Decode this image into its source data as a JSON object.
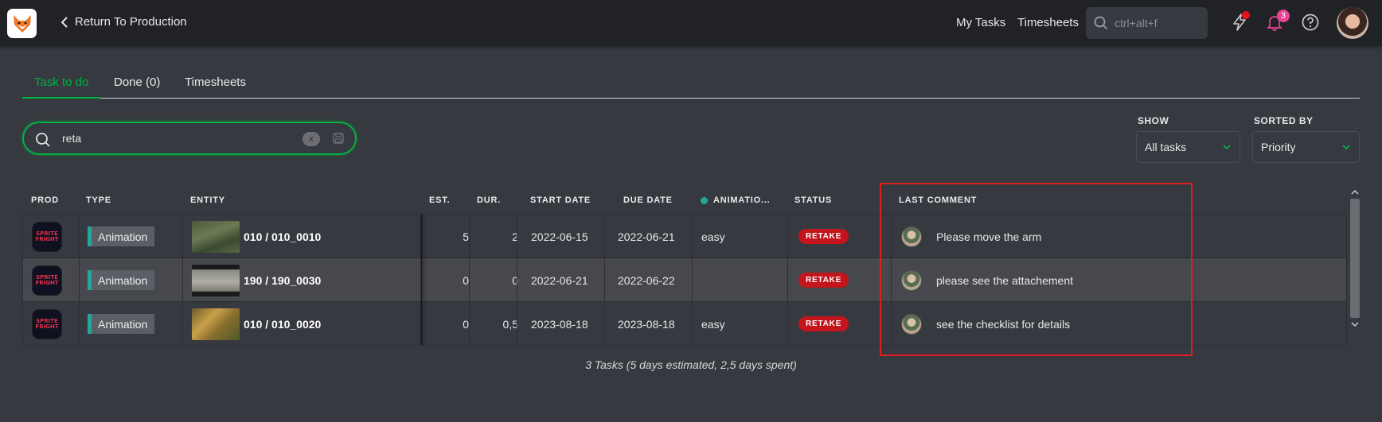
{
  "topbar": {
    "back_label": "Return To Production",
    "nav": {
      "my_tasks": "My Tasks",
      "timesheets": "Timesheets"
    },
    "search_placeholder": "ctrl+alt+f",
    "notifications_count": "3"
  },
  "tabs": [
    {
      "label": "Task to do",
      "active": true
    },
    {
      "label": "Done (0)",
      "active": false
    },
    {
      "label": "Timesheets",
      "active": false
    }
  ],
  "search": {
    "value": "reta",
    "clear_label": "x"
  },
  "filters": {
    "show": {
      "label": "SHOW",
      "value": "All tasks"
    },
    "sorted_by": {
      "label": "SORTED BY",
      "value": "Priority"
    }
  },
  "table": {
    "columns": {
      "prod": "PROD",
      "type": "TYPE",
      "entity": "ENTITY",
      "est": "EST.",
      "dur": "DUR.",
      "start_date": "START DATE",
      "due_date": "DUE DATE",
      "animation": "ANIMATIO...",
      "status": "STATUS",
      "last_comment": "LAST COMMENT"
    },
    "prod_thumb_text": [
      "SPRITE",
      "FRIGHT"
    ],
    "rows": [
      {
        "type": "Animation",
        "entity": "010 / 010_0010",
        "est": "5",
        "dur": "2",
        "start_date": "2022-06-15",
        "due_date": "2022-06-21",
        "animation": "easy",
        "status": "RETAKE",
        "comment": "Please move the arm"
      },
      {
        "type": "Animation",
        "entity": "190 / 190_0030",
        "est": "0",
        "dur": "0",
        "start_date": "2022-06-21",
        "due_date": "2022-06-22",
        "animation": "",
        "status": "RETAKE",
        "comment": "please see the attachement"
      },
      {
        "type": "Animation",
        "entity": "010 / 010_0020",
        "est": "0",
        "dur": "0,5",
        "start_date": "2023-08-18",
        "due_date": "2023-08-18",
        "animation": "easy",
        "status": "RETAKE",
        "comment": "see the checklist for details"
      }
    ]
  },
  "summary": "3 Tasks (5 days estimated, 2,5 days spent)",
  "colors": {
    "accent": "#00b242",
    "status_retake": "#c4141c",
    "type_animation": "#26a69a",
    "highlight": "#e01e1e"
  }
}
